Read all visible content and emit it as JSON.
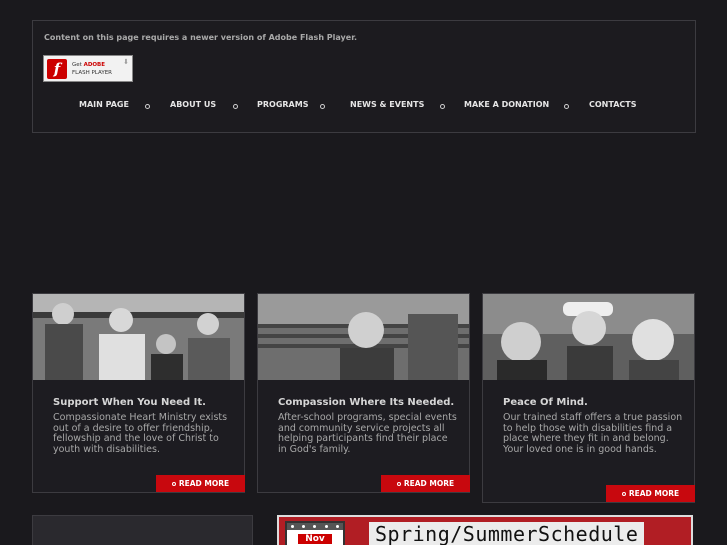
{
  "header": {
    "flash_message": "Content on this page requires a newer version of Adobe Flash Player.",
    "flash_badge": {
      "line1_prefix": "Get ",
      "line1_brand": "ADOBE",
      "line2": "FLASH PLAYER"
    }
  },
  "nav": {
    "items": [
      {
        "label": "MAIN PAGE"
      },
      {
        "label": "ABOUT US"
      },
      {
        "label": "PROGRAMS"
      },
      {
        "label": "NEWS & EVENTS"
      },
      {
        "label": "MAKE A DONATION"
      },
      {
        "label": "CONTACTS"
      }
    ]
  },
  "cards": [
    {
      "title": "Support When You Need It.",
      "body": "Compassionate Heart Ministry exists out of a desire to offer friendship, fellowship and the love of Christ to youth with disabilities.",
      "more": "READ MORE"
    },
    {
      "title": "Compassion Where Its Needed.",
      "body": "After-school programs, special events and community service projects all helping participants find their place in God's family.",
      "more": "READ MORE"
    },
    {
      "title": "Peace Of Mind.",
      "body": "Our trained staff offers a true passion to help those with disabilities find a place where they fit in and belong. Your loved one is in good hands.",
      "more": "READ MORE"
    }
  ],
  "banner": {
    "month": "Nov",
    "title": "Spring/SummerSchedule"
  },
  "colors": {
    "background": "#1a191d",
    "accent": "#c8080e",
    "text": "#bdbdbd"
  }
}
